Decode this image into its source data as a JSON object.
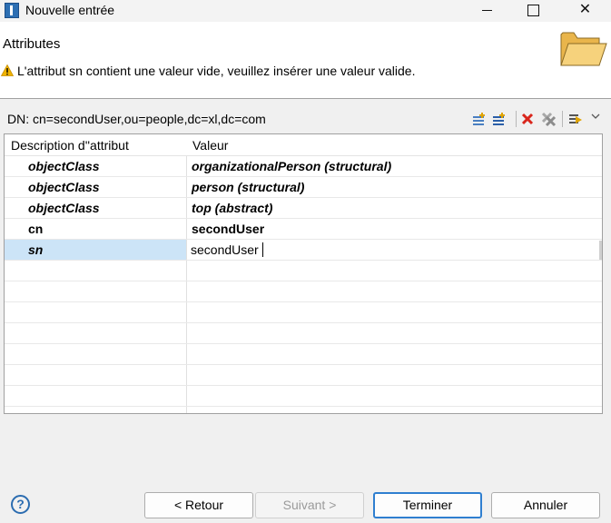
{
  "window": {
    "title": "Nouvelle entrée",
    "controls": {
      "minimize": "minimize",
      "maximize": "maximize",
      "close": "✕"
    }
  },
  "header": {
    "title": "Attributes",
    "message": "L'attribut sn contient une valeur vide, veuillez insérer une valeur valide."
  },
  "dn": {
    "label": "DN: cn=secondUser,ou=people,dc=xl,dc=com"
  },
  "toolbar": {
    "icons": [
      "new-attribute-icon",
      "new-value-icon",
      "delete-icon",
      "delete-all-icon",
      "edit-icon",
      "view-menu-icon"
    ]
  },
  "table": {
    "columns": [
      "Description d''attribut",
      "Valeur"
    ],
    "rows": [
      {
        "attribute": "objectClass",
        "value": "organizationalPerson (structural)"
      },
      {
        "attribute": "objectClass",
        "value": "person (structural)"
      },
      {
        "attribute": "objectClass",
        "value": "top (abstract)"
      },
      {
        "attribute": "cn",
        "value": "secondUser"
      },
      {
        "attribute": "sn",
        "value": "secondUser"
      }
    ]
  },
  "buttons": {
    "help": "?",
    "back": "< Retour",
    "next": "Suivant >",
    "finish": "Terminer",
    "cancel": "Annuler"
  },
  "colors": {
    "selection": "#cce4f7",
    "default_button_border": "#2f7fd0",
    "warning": "#f0b400",
    "delete": "#d9261c"
  }
}
